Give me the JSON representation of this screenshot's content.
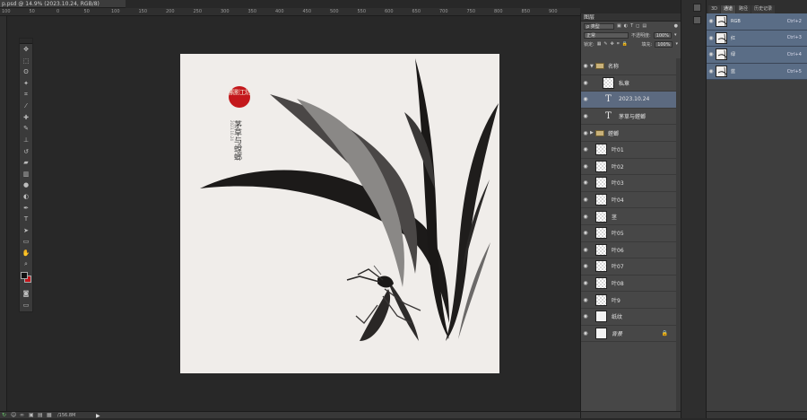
{
  "document": {
    "tab_title": "p.psd @ 14.9% (2023.10.24, RGB/8)",
    "zoom": "14.9%",
    "status_size": "/156.8M"
  },
  "ruler": {
    "top_labels": [
      "100",
      "50",
      "0",
      "50",
      "100",
      "150",
      "200",
      "250",
      "300",
      "350",
      "400",
      "450",
      "500",
      "550",
      "600",
      "650",
      "700",
      "750",
      "800",
      "850",
      "900"
    ]
  },
  "tools": [
    "move-tool",
    "marquee-tool",
    "lasso-tool",
    "quick-select-tool",
    "crop-tool",
    "eyedropper-tool",
    "healing-tool",
    "brush-tool",
    "stamp-tool",
    "history-brush-tool",
    "eraser-tool",
    "gradient-tool",
    "blur-tool",
    "dodge-tool",
    "pen-tool",
    "type-tool",
    "path-select-tool",
    "shape-tool",
    "hand-tool",
    "zoom-tool"
  ],
  "canvas_art": {
    "seal_text": "素影工坊",
    "title": "茅草与螳螂",
    "date": "2023.10.24"
  },
  "layers_panel": {
    "tab_label": "图层",
    "filter_label": "ρ 类型",
    "blend_mode": "正常",
    "opacity_label": "不透明度:",
    "opacity_value": "100%",
    "lock_label": "锁定:",
    "fill_label": "填充:",
    "fill_value": "100%",
    "layers": [
      {
        "name": "名称",
        "type": "group",
        "expanded": true
      },
      {
        "name": "私章",
        "type": "pixel"
      },
      {
        "name": "2023.10.24",
        "type": "text",
        "selected": true
      },
      {
        "name": "茅草与螳螂",
        "type": "text"
      },
      {
        "name": "螳螂",
        "type": "group",
        "expanded": false
      },
      {
        "name": "叶01",
        "type": "pixel"
      },
      {
        "name": "叶02",
        "type": "pixel"
      },
      {
        "name": "叶03",
        "type": "pixel"
      },
      {
        "name": "叶04",
        "type": "pixel"
      },
      {
        "name": "茎",
        "type": "pixel"
      },
      {
        "name": "叶05",
        "type": "pixel"
      },
      {
        "name": "叶06",
        "type": "pixel"
      },
      {
        "name": "叶07",
        "type": "pixel"
      },
      {
        "name": "叶08",
        "type": "pixel"
      },
      {
        "name": "叶9",
        "type": "pixel"
      },
      {
        "name": "纸纹",
        "type": "plain"
      },
      {
        "name": "背景",
        "type": "background",
        "locked": true
      }
    ]
  },
  "channels_panel": {
    "tabs": [
      "3D",
      "通道",
      "路径",
      "历史记录"
    ],
    "active_tab": "通道",
    "channels": [
      {
        "name": "RGB",
        "shortcut": "Ctrl+2"
      },
      {
        "name": "红",
        "shortcut": "Ctrl+3"
      },
      {
        "name": "绿",
        "shortcut": "Ctrl+4"
      },
      {
        "name": "蓝",
        "shortcut": "Ctrl+5"
      }
    ]
  },
  "colors": {
    "foreground": "#111111",
    "background": "#c0141a",
    "selection": "#5c6a80",
    "seal": "#c4181c"
  }
}
